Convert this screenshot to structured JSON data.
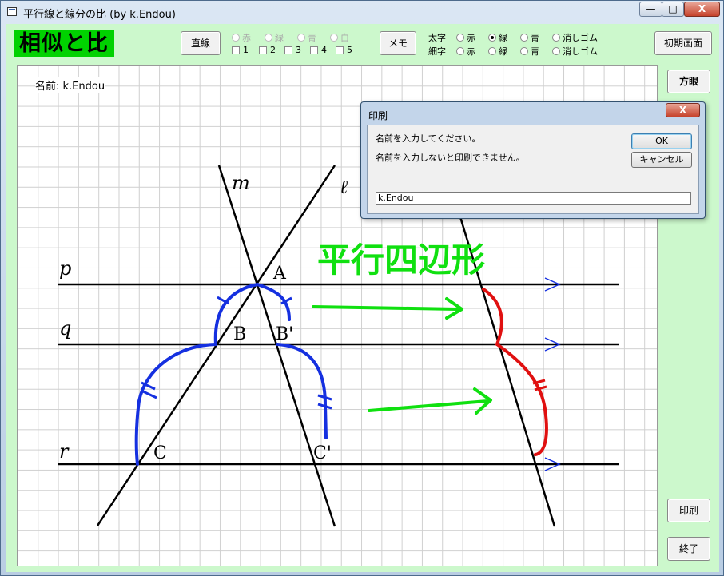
{
  "window": {
    "title": "平行線と線分の比 (by k.Endou)",
    "minimize_label": "—",
    "maximize_label": "□",
    "close_label": "X"
  },
  "toolbar": {
    "logo": "相似と比",
    "line_button": "直線",
    "line_colors": [
      "赤",
      "緑",
      "青",
      "白"
    ],
    "line_numbers": [
      "1",
      "2",
      "3",
      "4",
      "5"
    ],
    "memo_button": "メモ",
    "thick_label": "太字",
    "thin_label": "細字",
    "pen_colors": [
      "赤",
      "緑",
      "青",
      "消しゴム"
    ],
    "thick_selected": "緑",
    "reset_button": "初期画面",
    "grid_button": "方眼"
  },
  "canvas": {
    "name_label": "名前: k.Endou",
    "handwritten_text": "平行四辺形",
    "line_labels": [
      "m",
      "ℓ",
      "p",
      "q",
      "r"
    ],
    "point_labels": [
      "A",
      "B",
      "B'",
      "C",
      "C'"
    ],
    "colors": {
      "grid": "#d0d0d0",
      "lines": "#000000",
      "blue": "#1530e0",
      "green": "#10e010",
      "red": "#e01010"
    }
  },
  "side": {
    "print_button": "印刷",
    "exit_button": "終了"
  },
  "dialog": {
    "title": "印刷",
    "close_label": "X",
    "message1": "名前を入力してください。",
    "message2": "名前を入力しないと印刷できません。",
    "ok_button": "OK",
    "cancel_button": "キャンセル",
    "input_value": "k.Endou"
  }
}
